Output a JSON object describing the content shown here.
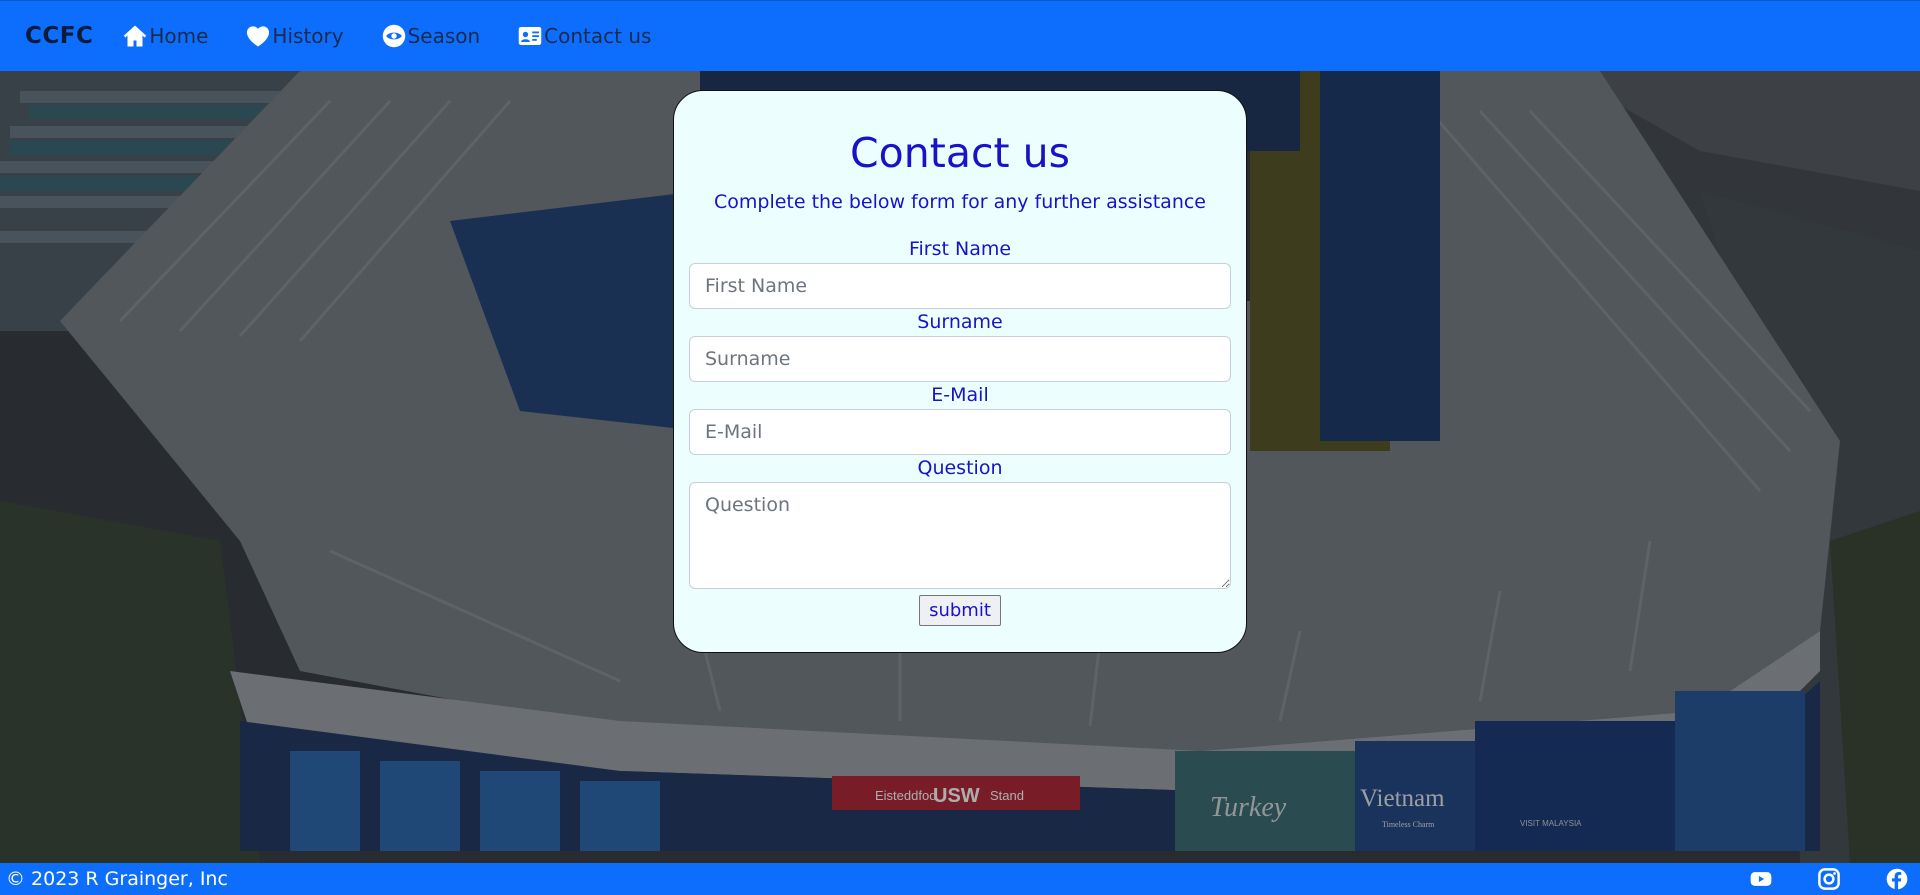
{
  "nav": {
    "brand": "CCFC",
    "items": [
      {
        "label": "Home",
        "icon": "house-icon"
      },
      {
        "label": "History",
        "icon": "heart-icon"
      },
      {
        "label": "Season",
        "icon": "eye-icon"
      },
      {
        "label": "Contact us",
        "icon": "person-card-icon"
      }
    ]
  },
  "form": {
    "title": "Contact us",
    "subtitle": "Complete the below form for any further assistance",
    "first_name": {
      "label": "First Name",
      "placeholder": "First Name"
    },
    "surname": {
      "label": "Surname",
      "placeholder": "Surname"
    },
    "email": {
      "label": "E-Mail",
      "placeholder": "E-Mail"
    },
    "question": {
      "label": "Question",
      "placeholder": "Question"
    },
    "submit_label": "submit"
  },
  "background": {
    "banner": {
      "prefix": "Eisteddfod",
      "main": "USW",
      "suffix": "Stand"
    },
    "ads": [
      "Turkey",
      "Vietnam",
      "Timeless Charm",
      "VISIT MALAYSIA"
    ]
  },
  "footer": {
    "copyright": "© 2023 R Grainger, Inc",
    "social": [
      "youtube-icon",
      "instagram-icon",
      "facebook-icon"
    ]
  },
  "colors": {
    "primary": "#0d6efd",
    "form_text": "#1a12c8",
    "card_bg": "#edfefe"
  }
}
